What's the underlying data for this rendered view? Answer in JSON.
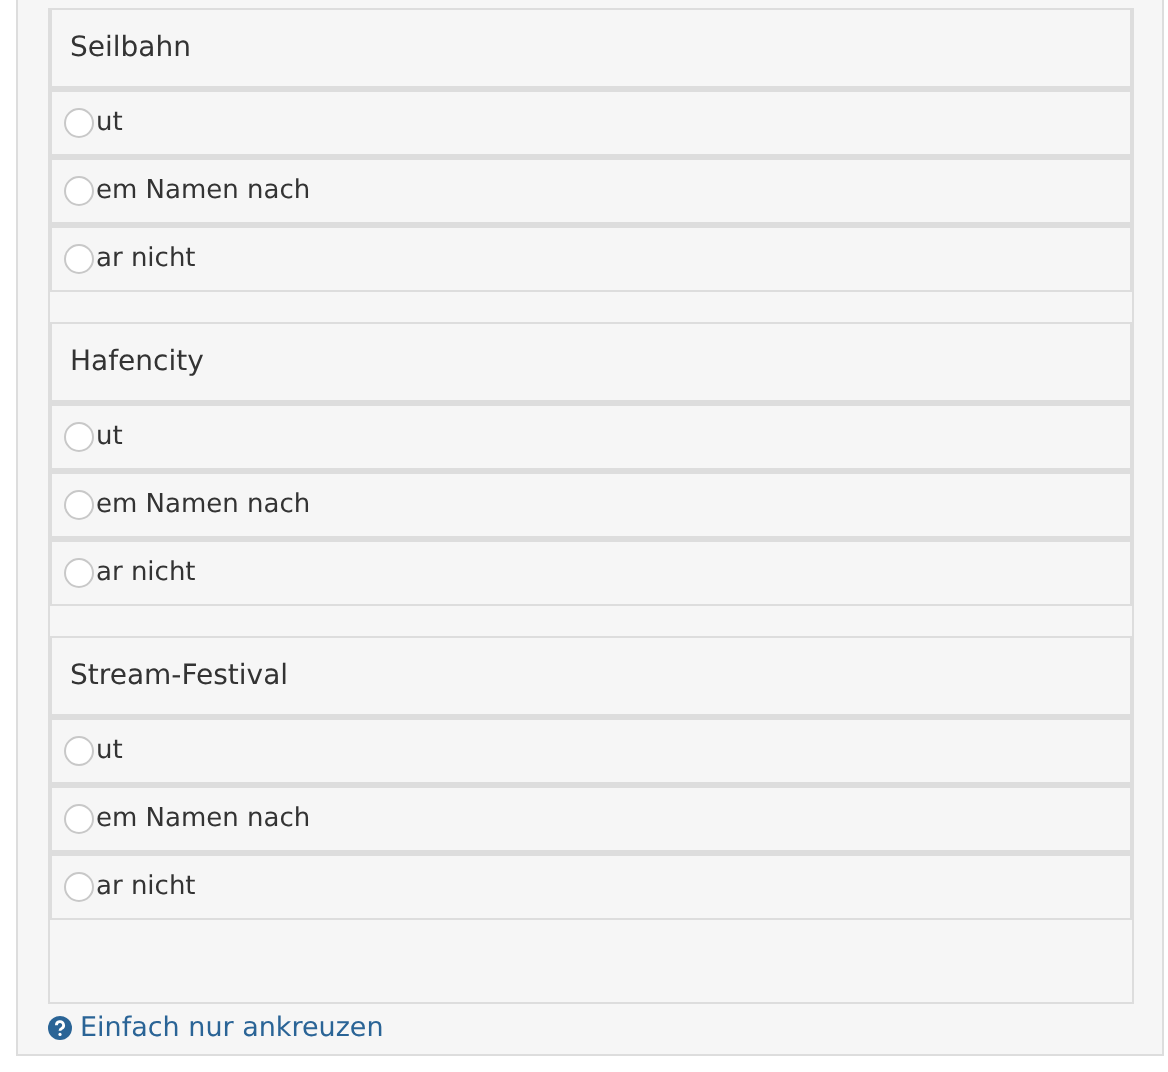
{
  "groups": [
    {
      "title": "Seilbahn",
      "options": [
        {
          "label": "ut",
          "selected": false
        },
        {
          "label": "em Namen nach",
          "selected": false
        },
        {
          "label": "ar nicht",
          "selected": false
        }
      ]
    },
    {
      "title": "Hafencity",
      "options": [
        {
          "label": "ut",
          "selected": false
        },
        {
          "label": "em Namen nach",
          "selected": false
        },
        {
          "label": "ar nicht",
          "selected": false
        }
      ]
    },
    {
      "title": "Stream-Festival",
      "options": [
        {
          "label": "ut",
          "selected": false
        },
        {
          "label": "em Namen nach",
          "selected": false
        },
        {
          "label": "ar nicht",
          "selected": false
        }
      ]
    }
  ],
  "help": "Einfach nur ankreuzen"
}
